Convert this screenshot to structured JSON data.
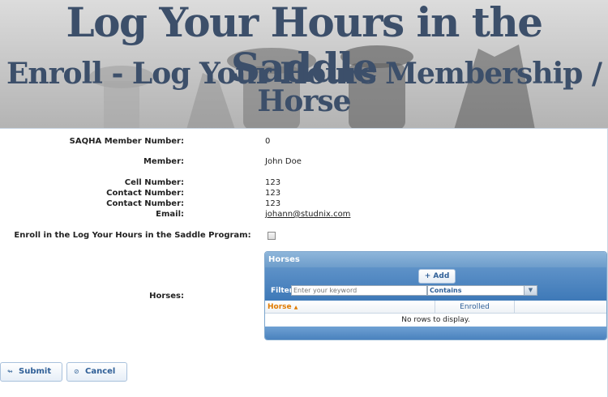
{
  "banner": {
    "title": "Log Your Hours in the Saddle",
    "subtitle": "Enroll - Log Your Hours Membership / Horse"
  },
  "form": {
    "member_number_label": "SAQHA Member Number:",
    "member_number_value": "0",
    "member_label": "Member:",
    "member_value": "John Doe",
    "cell_label": "Cell Number:",
    "cell_value": "123",
    "contact1_label": "Contact Number:",
    "contact1_value": "123",
    "contact2_label": "Contact Number:",
    "contact2_value": "123",
    "email_label": "Email:",
    "email_value": "johann@studnix.com",
    "enroll_label": "Enroll in the Log Your Hours in the Saddle Program:",
    "enroll_checked": false,
    "horses_label": "Horses:"
  },
  "horses_grid": {
    "title": "Horses",
    "add_label": "Add",
    "add_icon": "plus-icon",
    "filter_label": "Filter",
    "filter_placeholder": "Enter your keyword",
    "filter_mode": "Contains",
    "columns": [
      "Horse",
      "Enrolled"
    ],
    "sort_indicator": "▲",
    "empty_message": "No rows to display."
  },
  "actions": {
    "submit_label": "Submit",
    "submit_icon": "submit-arrow-icon",
    "cancel_label": "Cancel",
    "cancel_icon": "cancel-circle-icon"
  }
}
